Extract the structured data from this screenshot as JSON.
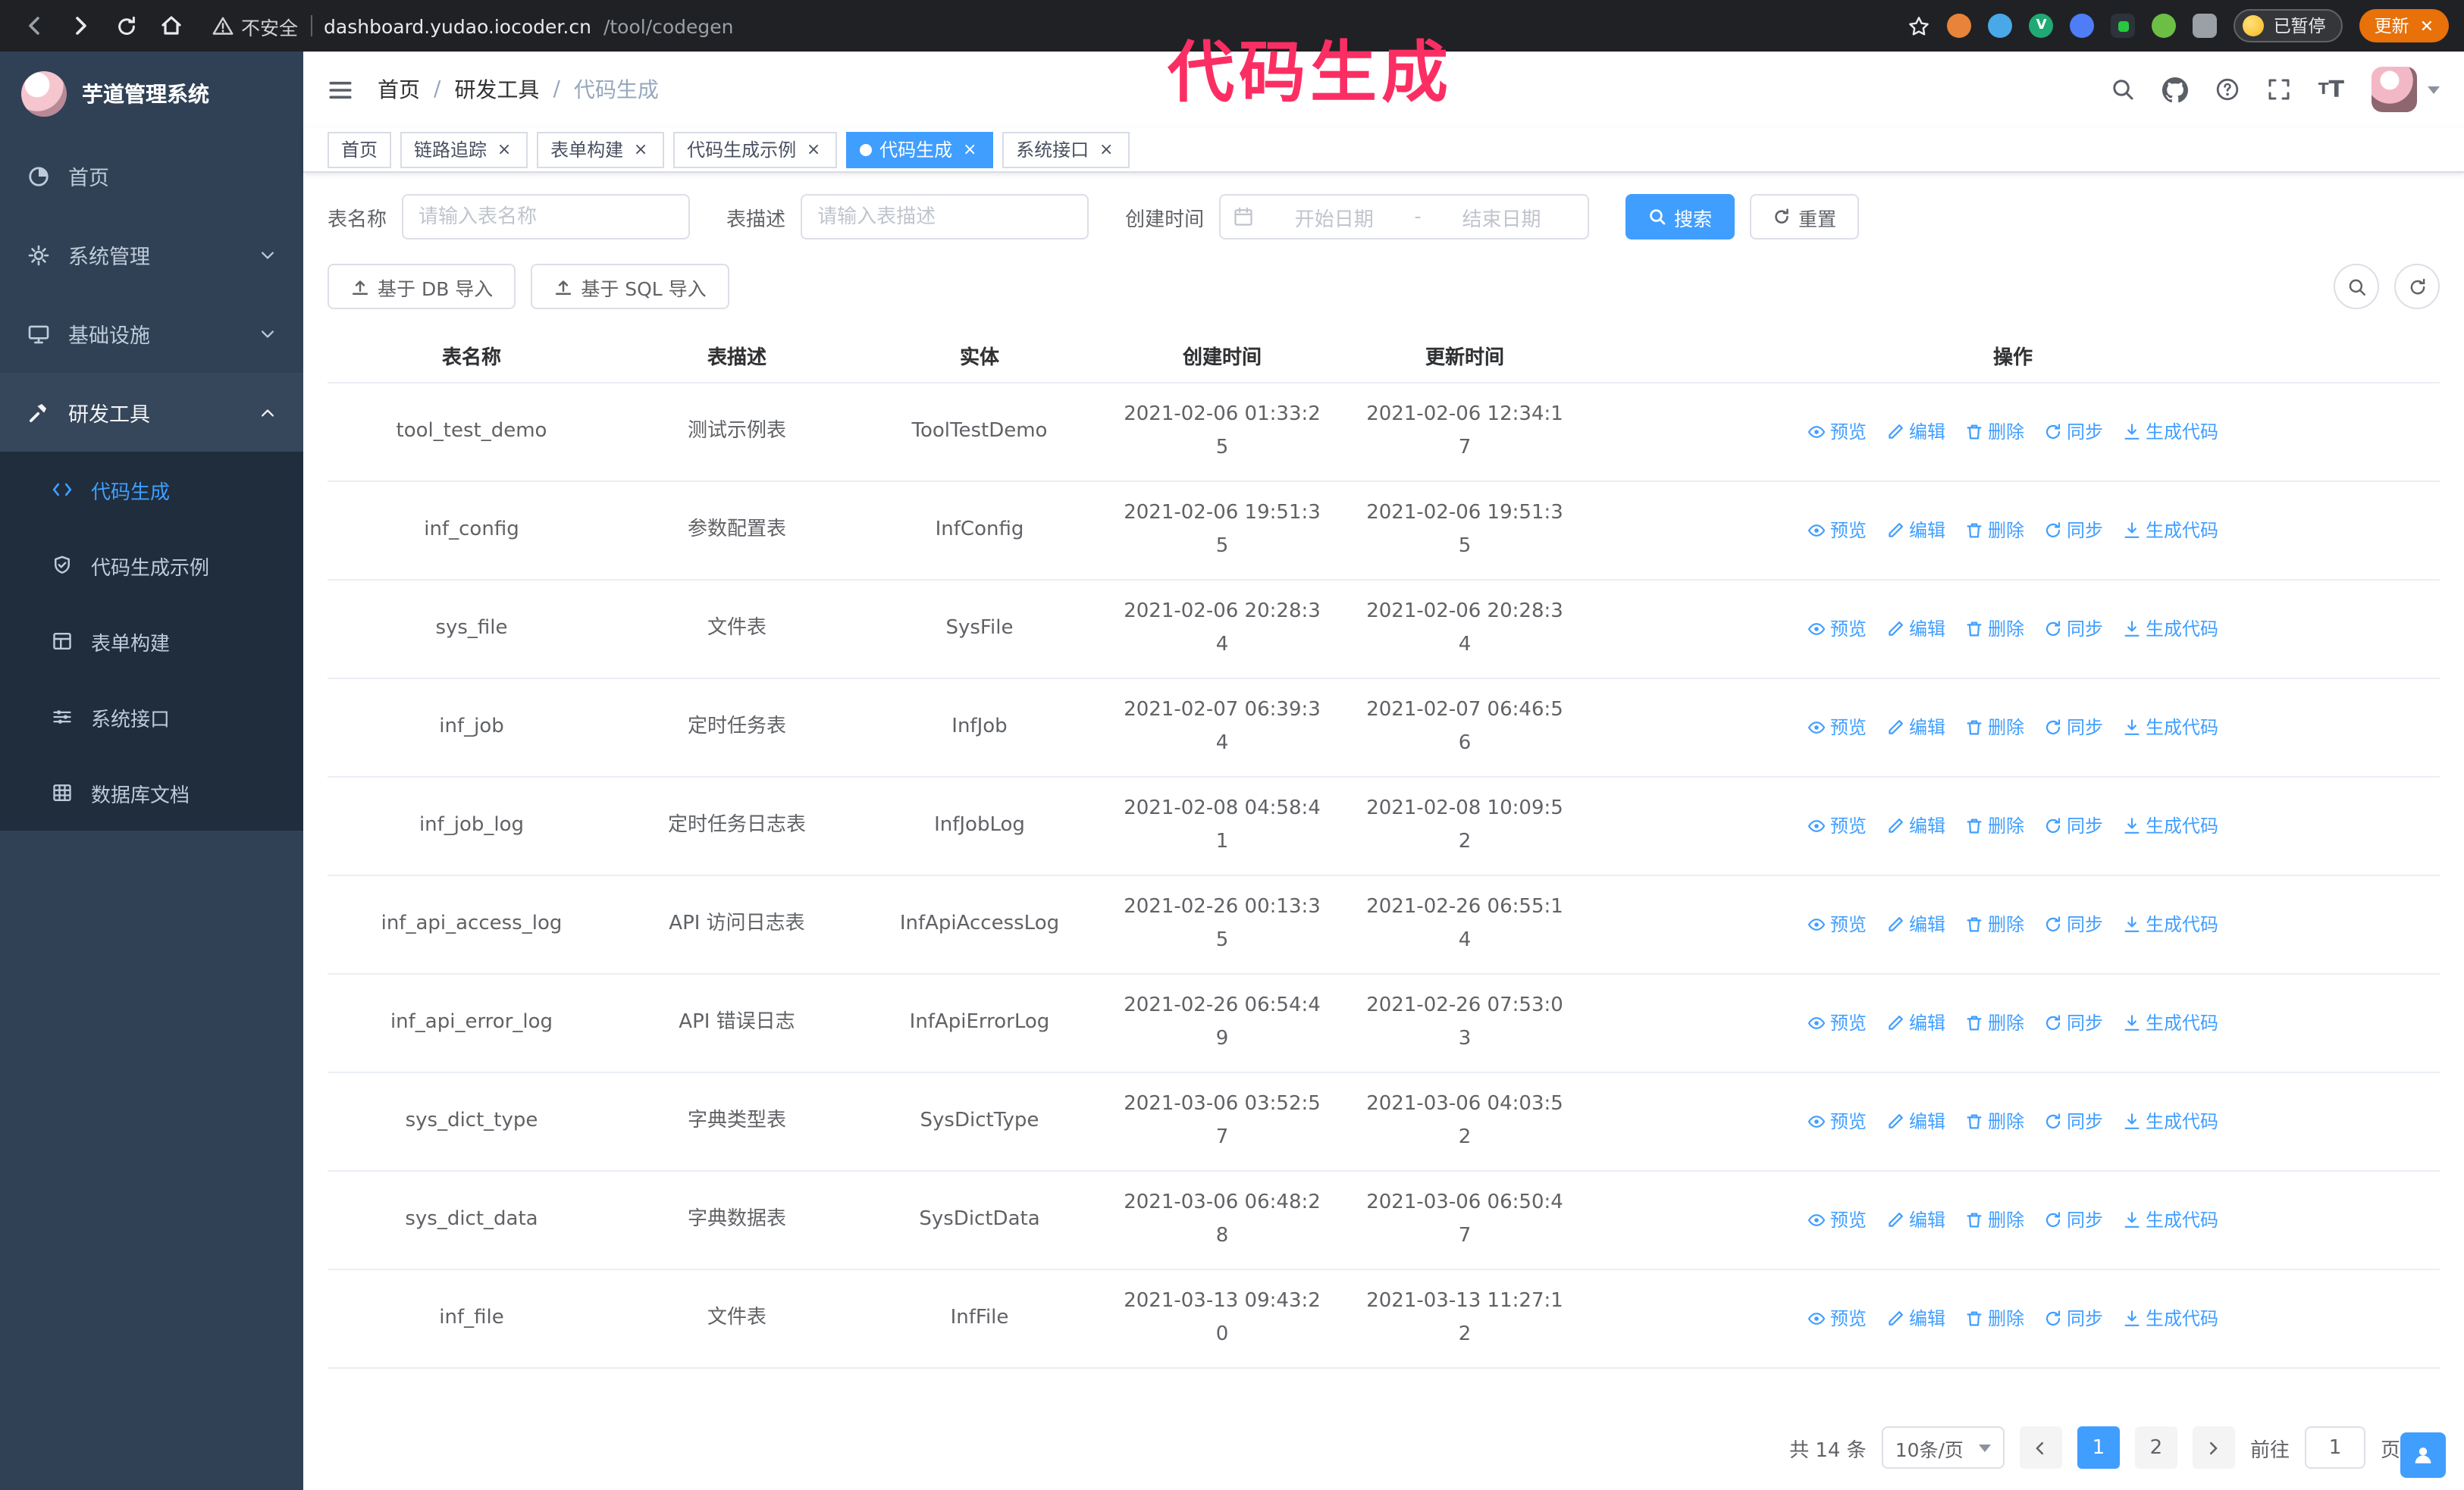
{
  "theme": {
    "accent": "#409eff",
    "sidebar_bg": "#304156",
    "submenu_bg": "#1f2d3d",
    "chrome_bg": "#202124",
    "update_color": "#e8710a",
    "annotation_color": "#fb2e63"
  },
  "annotation": {
    "text": "代码生成"
  },
  "browser": {
    "security_warning": "不安全",
    "url_host": "dashboard.yudao.iocoder.cn",
    "url_path": "/tool/codegen",
    "paused_badge": "已暂停",
    "update_button": "更新"
  },
  "sidebar": {
    "app_title": "芋道管理系统",
    "items": [
      {
        "label": "首页"
      },
      {
        "label": "系统管理"
      },
      {
        "label": "基础设施"
      },
      {
        "label": "研发工具"
      }
    ],
    "subitems": [
      {
        "label": "代码生成",
        "active": true
      },
      {
        "label": "代码生成示例"
      },
      {
        "label": "表单构建"
      },
      {
        "label": "系统接口"
      },
      {
        "label": "数据库文档"
      }
    ]
  },
  "breadcrumb": {
    "items": [
      "首页",
      "研发工具",
      "代码生成"
    ],
    "separator": "/"
  },
  "tabs": [
    {
      "label": "首页",
      "closable": false
    },
    {
      "label": "链路追踪",
      "closable": true
    },
    {
      "label": "表单构建",
      "closable": true
    },
    {
      "label": "代码生成示例",
      "closable": true
    },
    {
      "label": "代码生成",
      "closable": true,
      "active": true
    },
    {
      "label": "系统接口",
      "closable": true
    }
  ],
  "filters": {
    "table_name_label": "表名称",
    "table_name_placeholder": "请输入表名称",
    "table_desc_label": "表描述",
    "table_desc_placeholder": "请输入表描述",
    "create_time_label": "创建时间",
    "date_start_placeholder": "开始日期",
    "date_separator": "-",
    "date_end_placeholder": "结束日期",
    "search_button": "搜索",
    "reset_button": "重置"
  },
  "toolbar": {
    "import_db_button": "基于 DB 导入",
    "import_sql_button": "基于 SQL 导入"
  },
  "table": {
    "columns": [
      "表名称",
      "表描述",
      "实体",
      "创建时间",
      "更新时间",
      "操作"
    ],
    "actions": [
      "预览",
      "编辑",
      "删除",
      "同步",
      "生成代码"
    ],
    "rows": [
      {
        "name": "tool_test_demo",
        "desc": "测试示例表",
        "entity": "ToolTestDemo",
        "created": "2021-02-06 01:33:25",
        "updated": "2021-02-06 12:34:17"
      },
      {
        "name": "inf_config",
        "desc": "参数配置表",
        "entity": "InfConfig",
        "created": "2021-02-06 19:51:35",
        "updated": "2021-02-06 19:51:35"
      },
      {
        "name": "sys_file",
        "desc": "文件表",
        "entity": "SysFile",
        "created": "2021-02-06 20:28:34",
        "updated": "2021-02-06 20:28:34"
      },
      {
        "name": "inf_job",
        "desc": "定时任务表",
        "entity": "InfJob",
        "created": "2021-02-07 06:39:34",
        "updated": "2021-02-07 06:46:56"
      },
      {
        "name": "inf_job_log",
        "desc": "定时任务日志表",
        "entity": "InfJobLog",
        "created": "2021-02-08 04:58:41",
        "updated": "2021-02-08 10:09:52"
      },
      {
        "name": "inf_api_access_log",
        "desc": "API 访问日志表",
        "entity": "InfApiAccessLog",
        "created": "2021-02-26 00:13:35",
        "updated": "2021-02-26 06:55:14"
      },
      {
        "name": "inf_api_error_log",
        "desc": "API 错误日志",
        "entity": "InfApiErrorLog",
        "created": "2021-02-26 06:54:49",
        "updated": "2021-02-26 07:53:03"
      },
      {
        "name": "sys_dict_type",
        "desc": "字典类型表",
        "entity": "SysDictType",
        "created": "2021-03-06 03:52:57",
        "updated": "2021-03-06 04:03:52"
      },
      {
        "name": "sys_dict_data",
        "desc": "字典数据表",
        "entity": "SysDictData",
        "created": "2021-03-06 06:48:28",
        "updated": "2021-03-06 06:50:47"
      },
      {
        "name": "inf_file",
        "desc": "文件表",
        "entity": "InfFile",
        "created": "2021-03-13 09:43:20",
        "updated": "2021-03-13 11:27:12"
      }
    ]
  },
  "pagination": {
    "total": "共 14 条",
    "page_size": "10条/页",
    "pages": [
      "1",
      "2"
    ],
    "active_page": "1",
    "goto_label": "前往",
    "goto_value": "1",
    "page_label": "页"
  }
}
